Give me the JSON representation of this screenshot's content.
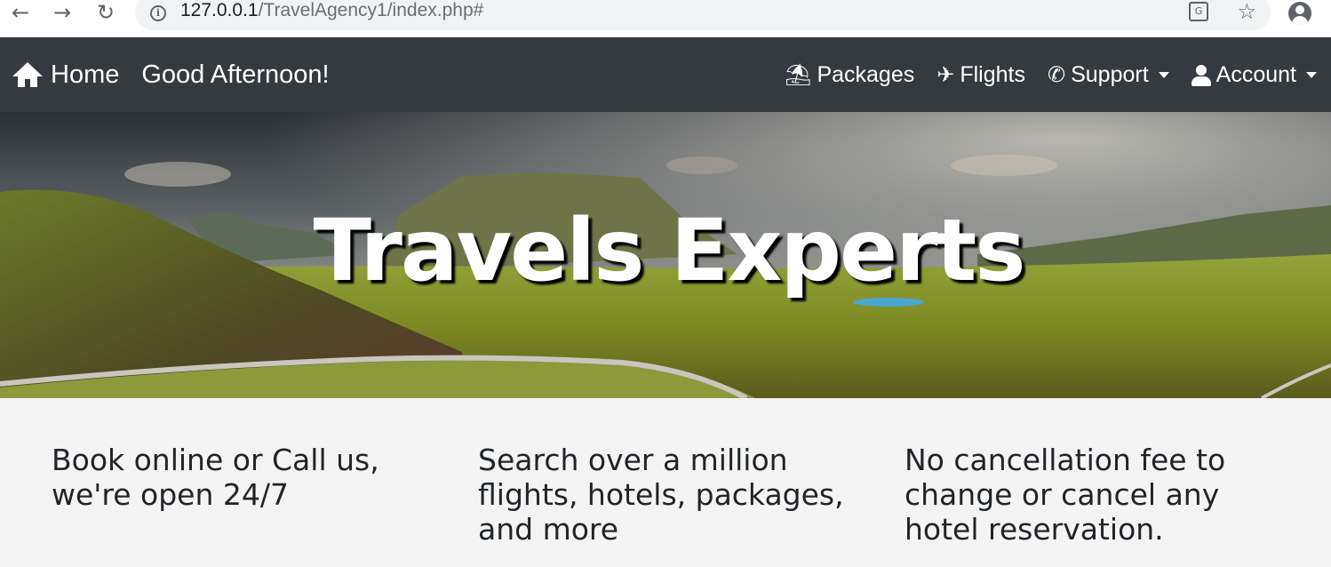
{
  "browser": {
    "url_host": "127.0.0.1",
    "url_path": "/TravelAgency1/index.php#"
  },
  "navbar": {
    "home_label": "Home",
    "greeting": "Good Afternoon!",
    "items": [
      {
        "label": "Packages",
        "icon": "umbrella-beach-icon"
      },
      {
        "label": "Flights",
        "icon": "plane-icon"
      },
      {
        "label": "Support",
        "icon": "phone-icon",
        "dropdown": true
      },
      {
        "label": "Account",
        "icon": "user-icon",
        "dropdown": true
      }
    ],
    "background": "#343a40"
  },
  "hero": {
    "title": "Travels Experts"
  },
  "features": [
    {
      "text": "Book online or Call us, we're open 24/7"
    },
    {
      "text": "Search over a million flights, hotels, packages, and more"
    },
    {
      "text": "No cancellation fee to change or cancel any hotel reservation."
    }
  ]
}
